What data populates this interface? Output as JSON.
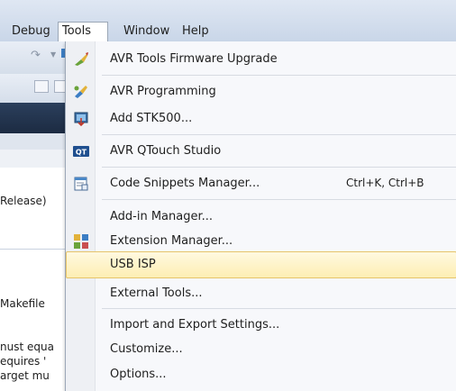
{
  "menubar": {
    "menus": [
      "Debug",
      "Tools",
      "Window",
      "Help"
    ],
    "active_menu": "Tools"
  },
  "background": {
    "clipped_text": [
      "Release)",
      "Makefile",
      "nust equa",
      "equires '",
      "arget mu"
    ]
  },
  "tools_menu": {
    "items": [
      {
        "label": "AVR Tools Firmware Upgrade",
        "icon": "firmware-upgrade-icon"
      },
      {
        "label": "AVR Programming",
        "icon": "programming-icon"
      },
      {
        "label": "Add STK500...",
        "icon": "stk500-icon"
      },
      {
        "label": "AVR QTouch Studio",
        "icon": "qtouch-icon"
      },
      {
        "label": "Code Snippets Manager...",
        "shortcut": "Ctrl+K, Ctrl+B",
        "icon": "code-snippets-icon"
      },
      {
        "label": "Add-in Manager..."
      },
      {
        "label": "Extension Manager...",
        "icon": "extension-manager-icon"
      },
      {
        "label": "USB ISP",
        "highlighted": true
      },
      {
        "label": "External Tools..."
      },
      {
        "label": "Import and Export Settings..."
      },
      {
        "label": "Customize..."
      },
      {
        "label": "Options..."
      }
    ]
  },
  "colors": {
    "highlight_bg": "#fdeeb3",
    "highlight_border": "#e6c46a",
    "menu_bg": "#f7f8fb",
    "qtouch_blue": "#1f4f8f"
  }
}
